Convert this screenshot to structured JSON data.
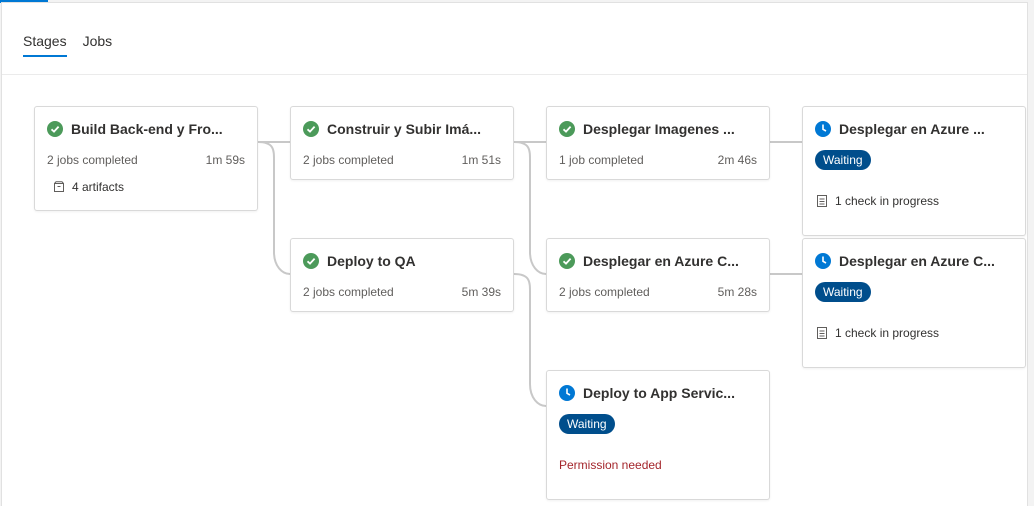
{
  "tabs": [
    {
      "label": "Stages",
      "active": true
    },
    {
      "label": "Jobs",
      "active": false
    }
  ],
  "colors": {
    "accent": "#0078d4",
    "success": "#4c9a5a",
    "waiting_badge": "#004e8c",
    "clock": "#0078d4",
    "error_text": "#a4262c"
  },
  "stages": [
    {
      "title": "Build Back-end y Fro...",
      "status_icon": "check-circle-icon",
      "jobs": "2 jobs completed",
      "duration": "1m 59s",
      "artifacts": "4 artifacts"
    },
    {
      "title": "Construir y Subir Imá...",
      "status_icon": "check-circle-icon",
      "jobs": "2 jobs completed",
      "duration": "1m 51s"
    },
    {
      "title": "Desplegar Imagenes ...",
      "status_icon": "check-circle-icon",
      "jobs": "1 job completed",
      "duration": "2m 46s"
    },
    {
      "title": "Desplegar en Azure ...",
      "status_icon": "clock-icon",
      "badge": "Waiting",
      "check": "1 check in progress"
    },
    {
      "title": "Deploy to QA",
      "status_icon": "check-circle-icon",
      "jobs": "2 jobs completed",
      "duration": "5m 39s"
    },
    {
      "title": "Desplegar en Azure C...",
      "status_icon": "check-circle-icon",
      "jobs": "2 jobs completed",
      "duration": "5m 28s"
    },
    {
      "title": "Desplegar en Azure C...",
      "status_icon": "clock-icon",
      "badge": "Waiting",
      "check": "1 check in progress"
    },
    {
      "title": "Deploy to App Servic...",
      "status_icon": "clock-icon",
      "badge": "Waiting",
      "permission": "Permission needed"
    }
  ]
}
